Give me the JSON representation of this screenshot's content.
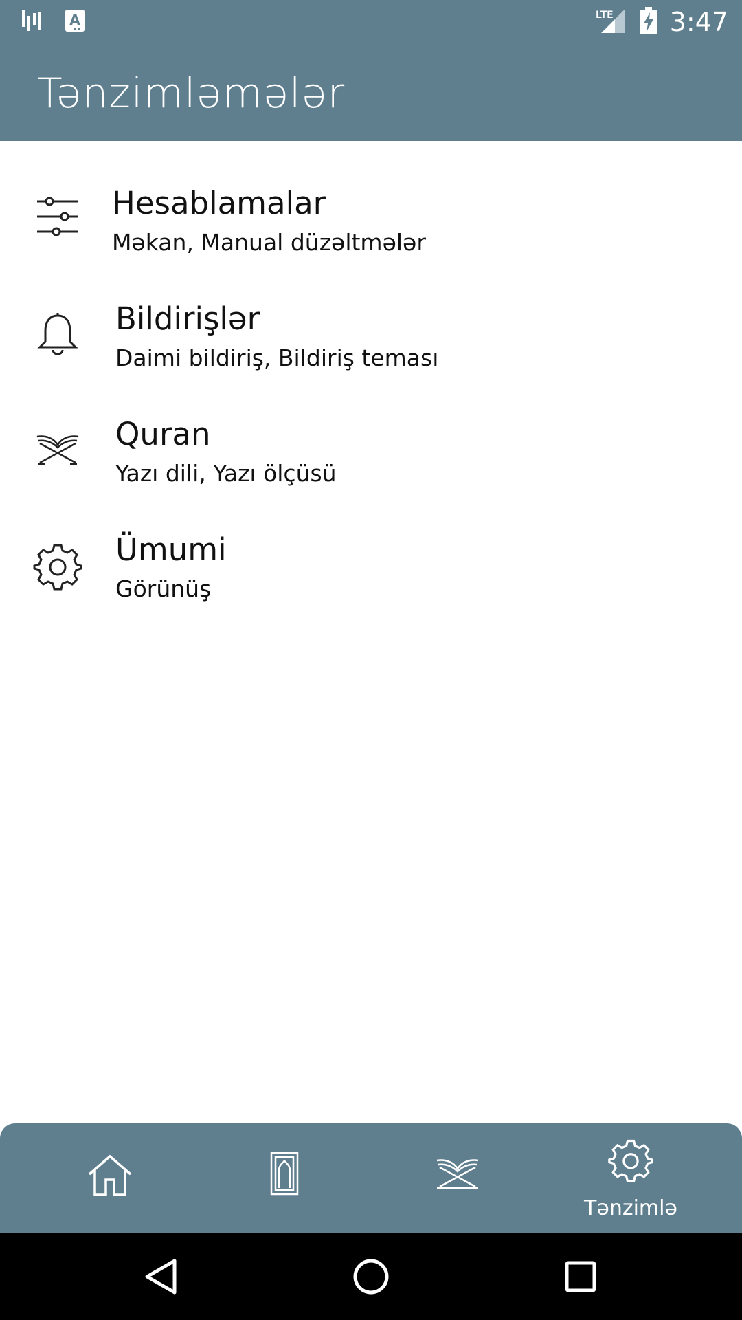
{
  "status_bar": {
    "time": "3:47",
    "network": "LTE",
    "icons": [
      "voicemail-icon",
      "keyboard-a-icon",
      "lte-signal-icon",
      "battery-charging-icon"
    ]
  },
  "app_bar": {
    "title": "Tənzimləmələr"
  },
  "settings": [
    {
      "icon": "sliders-icon",
      "title": "Hesablamalar",
      "subtitle": "Məkan, Manual düzəltmələr"
    },
    {
      "icon": "bell-icon",
      "title": "Bildirişlər",
      "subtitle": "Daimi bildiriş, Bildiriş teması"
    },
    {
      "icon": "quran-book-icon",
      "title": "Quran",
      "subtitle": "Yazı dili, Yazı ölçüsü"
    },
    {
      "icon": "gear-icon",
      "title": "Ümumi",
      "subtitle": "Görünüş"
    }
  ],
  "bottom_nav": {
    "items": [
      {
        "icon": "home-icon",
        "label": ""
      },
      {
        "icon": "prayer-rug-icon",
        "label": ""
      },
      {
        "icon": "quran-book-icon",
        "label": ""
      },
      {
        "icon": "gear-icon",
        "label": "Tənzimlə",
        "active": true
      }
    ]
  },
  "colors": {
    "primary": "#5f7f8f",
    "background": "#ffffff",
    "text": "#111111",
    "system_nav": "#000000"
  }
}
